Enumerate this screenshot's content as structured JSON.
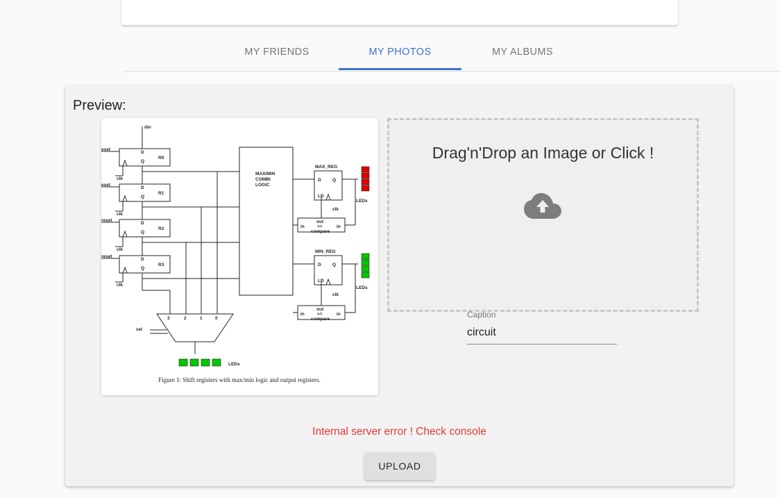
{
  "tabs": [
    {
      "label": "MY FRIENDS",
      "active": false
    },
    {
      "label": "MY PHOTOS",
      "active": true
    },
    {
      "label": "MY ALBUMS",
      "active": false
    }
  ],
  "upload": {
    "preview_label": "Preview:",
    "dropzone_text": "Drag'n'Drop an Image or Click !",
    "dropzone_icon": "cloud-upload-icon",
    "caption_label": "Caption",
    "caption_value": "circuit",
    "error_text": "Internal server error ! Check console",
    "error_color": "#e53935",
    "upload_label": "UPLOAD"
  },
  "preview_image": {
    "inputs": [
      "din",
      "sel"
    ],
    "clock_label": "clk",
    "register_pins": {
      "d": "D",
      "q": "Q"
    },
    "registers": [
      {
        "reset": "eset",
        "name": "R0"
      },
      {
        "reset": "eset",
        "name": "R1"
      },
      {
        "reset": "reset",
        "name": "R2"
      },
      {
        "reset": "reset",
        "name": "R3"
      }
    ],
    "logic_block": [
      "MAX/MIN",
      "COMBI",
      "LOGIC"
    ],
    "max_reg": {
      "title": "MAX_REG",
      "d": "D",
      "q": "Q",
      "ld": "LD",
      "clk": "clk"
    },
    "min_reg": {
      "title": "MIN_REG",
      "d": "D",
      "q": "Q",
      "ld": "LD",
      "clk": "clk"
    },
    "compare": {
      "in": "in",
      "out": "out",
      "op": ">=",
      "label": "compare"
    },
    "mux_inputs": [
      "3",
      "2",
      "1",
      "0"
    ],
    "leds_label": "LEDs",
    "led_colors": {
      "max": "#e00000",
      "min": "#00c800",
      "out": "#00c800"
    },
    "caption": "Figure 1: Shift registers with max/min logic and output registers."
  }
}
